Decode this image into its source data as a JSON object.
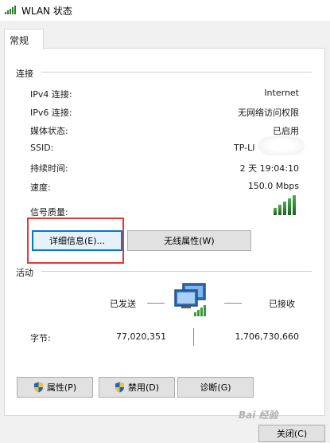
{
  "window": {
    "title": "WLAN 状态"
  },
  "tabs": [
    {
      "label": "常规"
    }
  ],
  "connection": {
    "header": "连接",
    "rows": [
      {
        "label": "IPv4 连接:",
        "value": "Internet"
      },
      {
        "label": "IPv6 连接:",
        "value": "无网络访问权限"
      },
      {
        "label": "媒体状态:",
        "value": "已启用"
      },
      {
        "label": "SSID:",
        "value": "TP-LI"
      },
      {
        "label": "持续时间:",
        "value": "2 天 19:04:10"
      },
      {
        "label": "速度:",
        "value": "150.0 Mbps"
      },
      {
        "label": "信号质量:",
        "value": ""
      }
    ],
    "signal_level": 1.0
  },
  "buttons": {
    "details": "详细信息(E)...",
    "wireless_props": "无线属性(W)",
    "properties": "属性(P)",
    "disable": "禁用(D)",
    "diagnose": "诊断(G)",
    "close": "关闭(C)"
  },
  "activity": {
    "header": "活动",
    "sent_label": "已发送",
    "received_label": "已接收",
    "bytes_label": "字节:",
    "bytes_sent": "77,020,351",
    "bytes_received": "1,706,730,660"
  },
  "watermark": "Bai 经验",
  "colors": {
    "accent": "#0078d7",
    "highlight": "#e53935",
    "signal": "#2e7d32"
  },
  "icons": [
    "wifi-signal-icon",
    "network-computer-icon",
    "uac-shield-icon"
  ]
}
